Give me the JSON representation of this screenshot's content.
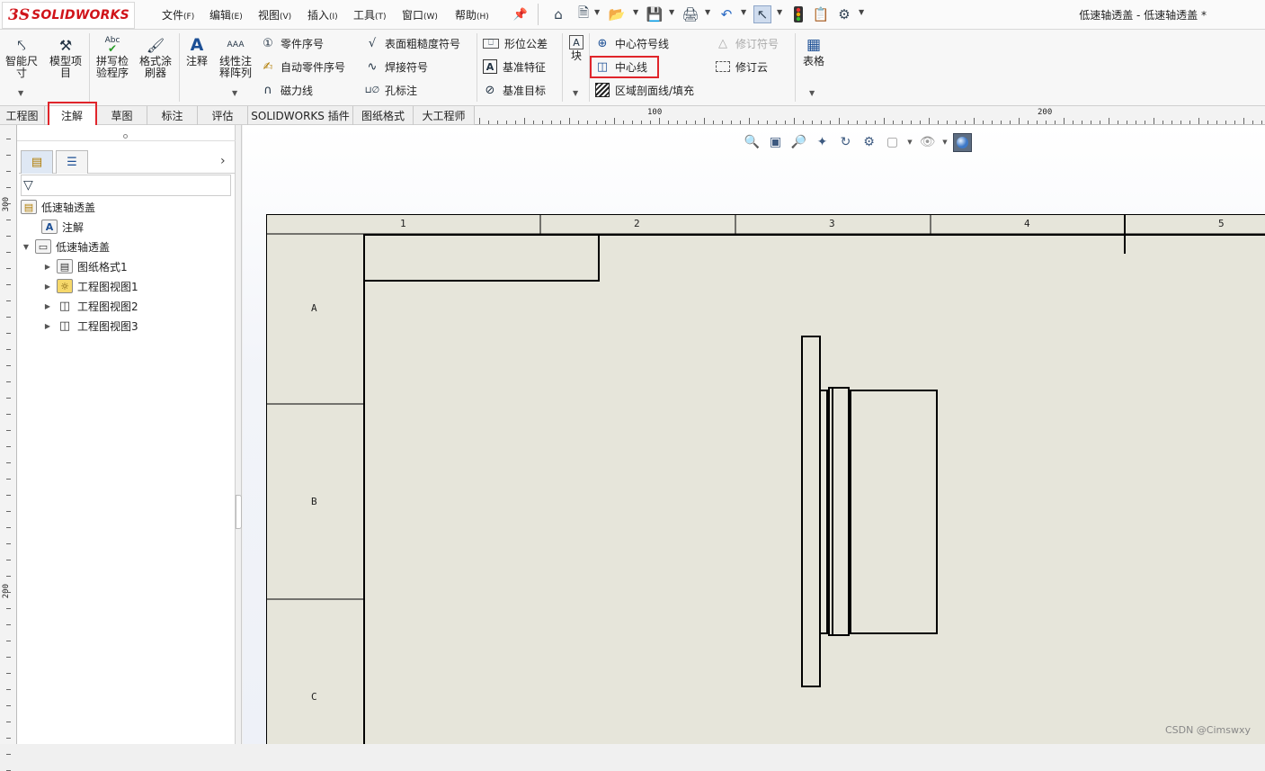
{
  "app": {
    "logo_ds": "3S",
    "logo_text": "SOLIDWORKS",
    "window_title": "低速轴透盖 - 低速轴透盖 *",
    "brand_color": "#d0141a",
    "highlight_color": "#e0252b"
  },
  "menu": [
    {
      "label": "文件",
      "key": "(F)"
    },
    {
      "label": "编辑",
      "key": "(E)"
    },
    {
      "label": "视图",
      "key": "(V)"
    },
    {
      "label": "插入",
      "key": "(I)"
    },
    {
      "label": "工具",
      "key": "(T)"
    },
    {
      "label": "窗口",
      "key": "(W)"
    },
    {
      "label": "帮助",
      "key": "(H)"
    }
  ],
  "ribbon": {
    "smart_dim": "智能尺\n寸",
    "model_items": "模型项\n目",
    "spell_check": "拼写检\n验程序",
    "format_painter": "格式涂\n刷器",
    "note": "注释",
    "linear_pattern": "线性注\n释阵列",
    "balloon": "零件序号",
    "auto_balloon": "自动零件序号",
    "magnetic_line": "磁力线",
    "surface_finish": "表面粗糙度符号",
    "weld_symbol": "焊接符号",
    "hole_callout": "孔标注",
    "gtol": "形位公差",
    "datum_feature": "基准特征",
    "datum_target": "基准目标",
    "block": "块",
    "center_mark": "中心符号线",
    "centerline": "中心线",
    "area_hatch": "区域剖面线/填充",
    "revision_symbol": "修订符号",
    "revision_cloud": "修订云",
    "table": "表格",
    "abc": "Abc"
  },
  "tabs": [
    "工程图",
    "注解",
    "草图",
    "标注",
    "评估",
    "SOLIDWORKS 插件",
    "图纸格式",
    "大工程师"
  ],
  "active_tab": "注解",
  "ruler": {
    "h_labels": [
      "100",
      "200"
    ],
    "v_labels": [
      "300",
      "200"
    ]
  },
  "tree": {
    "root": "低速轴透盖",
    "annotations": "注解",
    "sheet": "低速轴透盖",
    "children": [
      "图纸格式1",
      "工程图视图1",
      "工程图视图2",
      "工程图视图3"
    ]
  },
  "drawing": {
    "columns": [
      "1",
      "2",
      "3",
      "4",
      "5"
    ],
    "rows": [
      "A",
      "B",
      "C"
    ]
  },
  "watermark": "CSDN @Cimswxy"
}
